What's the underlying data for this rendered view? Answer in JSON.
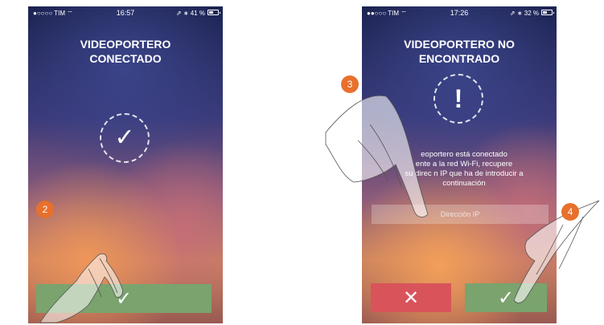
{
  "left_screen": {
    "status_bar": {
      "carrier": "●○○○○ TIM ⌔",
      "time": "16:57",
      "battery": "⇗ ∗ 41 %"
    },
    "title_line1": "VIDEOPORTERO",
    "title_line2": "CONECTADO",
    "status_icon": "check-icon",
    "check_glyph": "✓",
    "confirm_button": {
      "icon": "check-icon",
      "glyph": "✓",
      "color": "#7aa36e"
    }
  },
  "right_screen": {
    "status_bar": {
      "carrier": "●●○○○ TIM ⌔",
      "time": "17:26",
      "battery": "⇗ ∗ 32 %"
    },
    "title_line1": "VIDEOPORTERO NO",
    "title_line2": "ENCONTRADO",
    "status_icon": "exclamation-icon",
    "excl_glyph": "!",
    "message_line1": "eoportero está conectado",
    "message_line2": "ente a la red Wi-Fi, recupere",
    "message_line3": "su direc   n IP que ha de introducir a",
    "message_line4": "continuación",
    "ip_input_placeholder": "Dirección IP",
    "cancel_button": {
      "icon": "close-icon",
      "glyph": "✕",
      "color": "#d8545a"
    },
    "confirm_button": {
      "icon": "check-icon",
      "glyph": "✓",
      "color": "#7aa36e"
    }
  },
  "steps": {
    "step2": "2",
    "step3": "3",
    "step4": "4"
  },
  "colors": {
    "badge": "#e8702c"
  }
}
